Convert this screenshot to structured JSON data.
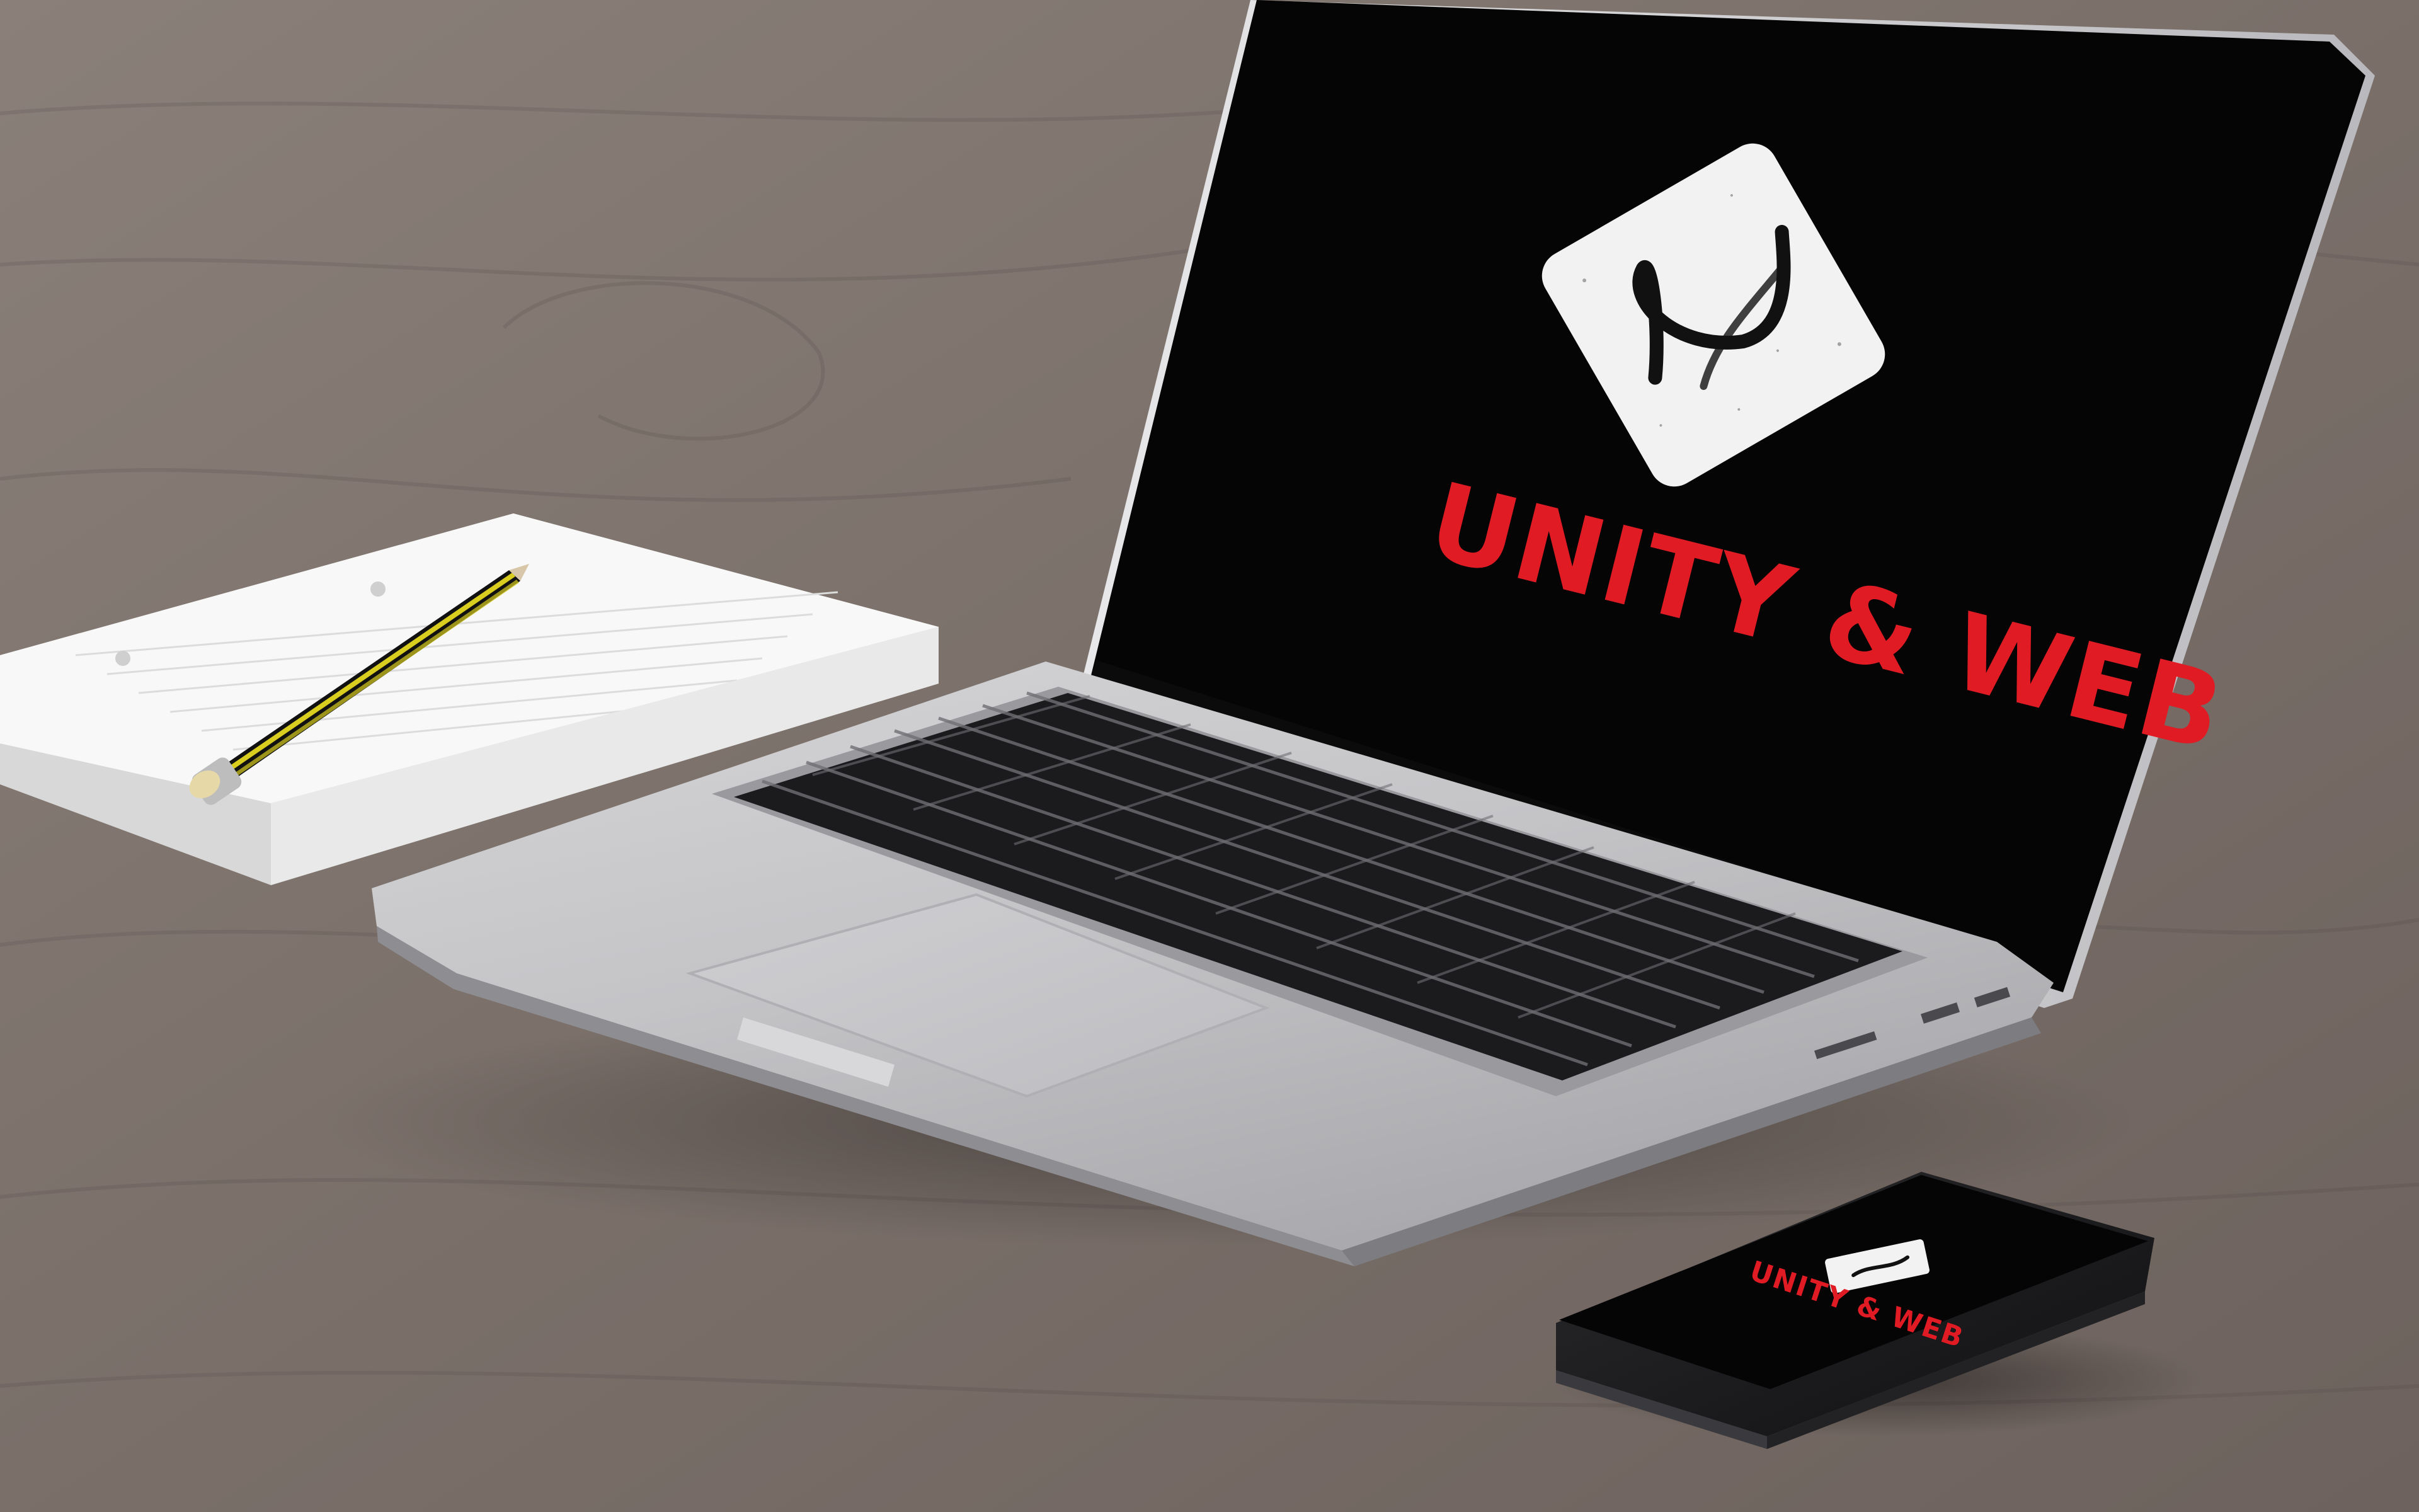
{
  "scene": {
    "description_hidden": "",
    "colors": {
      "desk": "#7b6f69",
      "desk_light": "#8a7e77",
      "screen": "#050505",
      "brand_red": "#e01b24",
      "aluminum": "#c9c9cb",
      "aluminum_dark": "#a7a7aa",
      "key": "#151515",
      "paper": "#f7f7f7",
      "pencil_yellow": "#d9cd1f",
      "pencil_black": "#111111"
    }
  },
  "laptop": {
    "brand_text": "UNITY & WEB",
    "logo_icon": "signature-u-logo-icon"
  },
  "phone": {
    "brand_text": "UNITY & WEB",
    "logo_icon": "signature-u-logo-icon"
  }
}
